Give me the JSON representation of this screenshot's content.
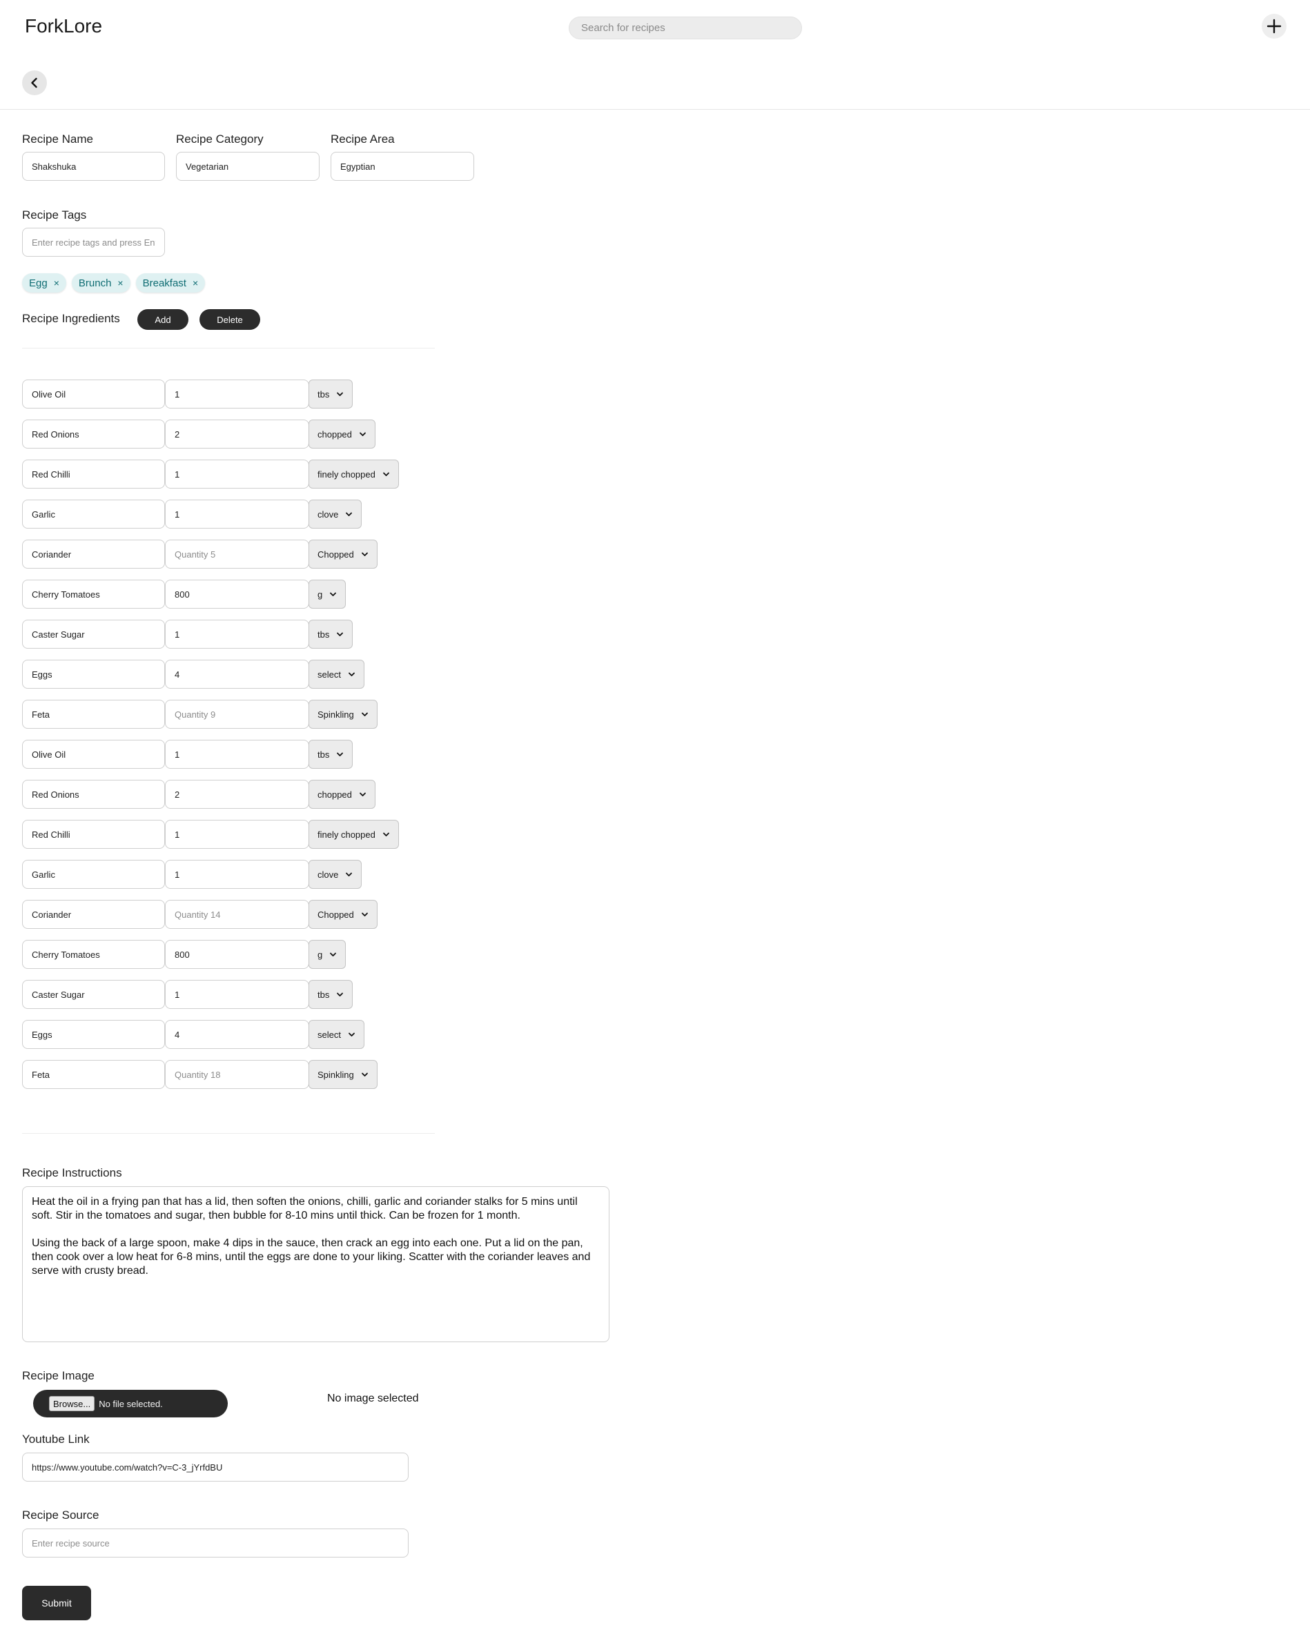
{
  "header": {
    "brand": "ForkLore",
    "search_placeholder": "Search for recipes",
    "add_icon": "plus-icon",
    "back_icon": "chevron-left-icon"
  },
  "form": {
    "name": {
      "label": "Recipe Name",
      "value": "Shakshuka"
    },
    "category": {
      "label": "Recipe Category",
      "value": "Vegetarian"
    },
    "area": {
      "label": "Recipe Area",
      "value": "Egyptian"
    },
    "tags": {
      "label": "Recipe Tags",
      "placeholder": "Enter recipe tags and press Enter",
      "items": [
        "Egg",
        "Brunch",
        "Breakfast"
      ],
      "remove_glyph": "×"
    },
    "ingredients": {
      "label": "Recipe Ingredients",
      "add_label": "Add",
      "delete_label": "Delete",
      "rows": [
        {
          "name": "Olive Oil",
          "quantity": "1",
          "placeholder": "",
          "unit": "tbs"
        },
        {
          "name": "Red Onions",
          "quantity": "2",
          "placeholder": "",
          "unit": "chopped"
        },
        {
          "name": "Red Chilli",
          "quantity": "1",
          "placeholder": "",
          "unit": "finely chopped"
        },
        {
          "name": "Garlic",
          "quantity": "1",
          "placeholder": "",
          "unit": "clove"
        },
        {
          "name": "Coriander",
          "quantity": "",
          "placeholder": "Quantity 5",
          "unit": "Chopped"
        },
        {
          "name": "Cherry Tomatoes",
          "quantity": "800",
          "placeholder": "",
          "unit": "g"
        },
        {
          "name": "Caster Sugar",
          "quantity": "1",
          "placeholder": "",
          "unit": "tbs"
        },
        {
          "name": "Eggs",
          "quantity": "4",
          "placeholder": "",
          "unit": "select"
        },
        {
          "name": "Feta",
          "quantity": "",
          "placeholder": "Quantity 9",
          "unit": "Spinkling"
        },
        {
          "name": "Olive Oil",
          "quantity": "1",
          "placeholder": "",
          "unit": "tbs"
        },
        {
          "name": "Red Onions",
          "quantity": "2",
          "placeholder": "",
          "unit": "chopped"
        },
        {
          "name": "Red Chilli",
          "quantity": "1",
          "placeholder": "",
          "unit": "finely chopped"
        },
        {
          "name": "Garlic",
          "quantity": "1",
          "placeholder": "",
          "unit": "clove"
        },
        {
          "name": "Coriander",
          "quantity": "",
          "placeholder": "Quantity 14",
          "unit": "Chopped"
        },
        {
          "name": "Cherry Tomatoes",
          "quantity": "800",
          "placeholder": "",
          "unit": "g"
        },
        {
          "name": "Caster Sugar",
          "quantity": "1",
          "placeholder": "",
          "unit": "tbs"
        },
        {
          "name": "Eggs",
          "quantity": "4",
          "placeholder": "",
          "unit": "select"
        },
        {
          "name": "Feta",
          "quantity": "",
          "placeholder": "Quantity 18",
          "unit": "Spinkling"
        }
      ]
    },
    "instructions": {
      "label": "Recipe Instructions",
      "value": "Heat the oil in a frying pan that has a lid, then soften the onions, chilli, garlic and coriander stalks for 5 mins until soft. Stir in the tomatoes and sugar, then bubble for 8-10 mins until thick. Can be frozen for 1 month.\n\nUsing the back of a large spoon, make 4 dips in the sauce, then crack an egg into each one. Put a lid on the pan, then cook over a low heat for 6-8 mins, until the eggs are done to your liking. Scatter with the coriander leaves and serve with crusty bread."
    },
    "image": {
      "label": "Recipe Image",
      "browse_label": "Browse...",
      "file_status": "No file selected.",
      "preview_text": "No image selected"
    },
    "youtube": {
      "label": "Youtube Link",
      "value": "https://www.youtube.com/watch?v=C-3_jYrfdBU"
    },
    "source": {
      "label": "Recipe Source",
      "placeholder": "Enter recipe source"
    },
    "submit_label": "Submit"
  },
  "colors": {
    "tag_bg": "#dff1f2",
    "tag_text": "#0f6d73",
    "dark_button": "#2c2c2c"
  }
}
